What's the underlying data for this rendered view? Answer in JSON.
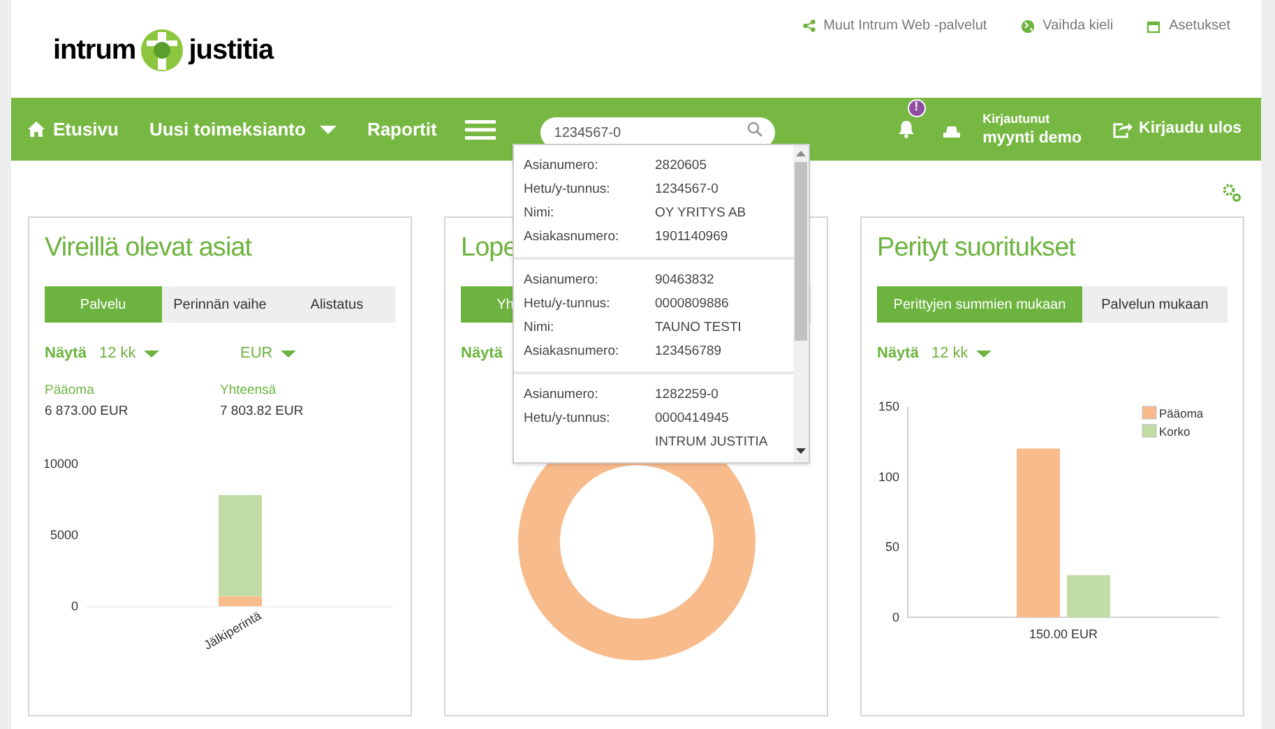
{
  "header": {
    "logo": {
      "left": "intrum",
      "right": "justitia"
    },
    "links": [
      {
        "kind": "share",
        "label": "Muut Intrum Web -palvelut"
      },
      {
        "kind": "globe",
        "label": "Vaihda kieli"
      },
      {
        "kind": "calendar",
        "label": "Asetukset"
      }
    ]
  },
  "nav": {
    "items": [
      {
        "kind": "home",
        "label": "Etusivu"
      },
      {
        "kind": "dropdown",
        "label": "Uusi toimeksianto"
      },
      {
        "kind": "plain",
        "label": "Raportit"
      },
      {
        "kind": "menu"
      }
    ],
    "search": {
      "value": "1234567-0"
    },
    "notifications": {
      "badge": "!"
    },
    "user": {
      "status": "Kirjautunut",
      "name": "myynti demo"
    },
    "logout": "Kirjaudu ulos"
  },
  "search_results": [
    {
      "fields": [
        {
          "label": "Asianumero:",
          "value": "2820605"
        },
        {
          "label": "Hetu/y-tunnus:",
          "value": "1234567-0"
        },
        {
          "label": "Nimi:",
          "value": "OY YRITYS AB"
        },
        {
          "label": "Asiakasnumero:",
          "value": "1901140969"
        }
      ]
    },
    {
      "fields": [
        {
          "label": "Asianumero:",
          "value": "90463832"
        },
        {
          "label": "Hetu/y-tunnus:",
          "value": "0000809886"
        },
        {
          "label": "Nimi:",
          "value": "TAUNO TESTI"
        },
        {
          "label": "Asiakasnumero:",
          "value": "123456789"
        }
      ]
    },
    {
      "fields": [
        {
          "label": "Asianumero:",
          "value": "1282259-0"
        },
        {
          "label": "Hetu/y-tunnus:",
          "value": "0000414945"
        },
        {
          "value": "INTRUM JUSTITIA"
        }
      ]
    }
  ],
  "cards": [
    {
      "kind": "stacked",
      "title": "Vireillä olevat asiat",
      "tabs": [
        {
          "label": "Palvelu",
          "selected": true
        },
        {
          "label": "Perinnän vaihe",
          "selected": false
        },
        {
          "label": "Alistatus",
          "selected": false
        }
      ],
      "filters": [
        {
          "label": "Näytä",
          "value": "12 kk"
        },
        {
          "value": "EUR"
        }
      ],
      "totals": [
        {
          "label": "Pääoma",
          "value": "6 873.00 EUR"
        },
        {
          "label": "Yhteensä",
          "value": "7 803.82 EUR"
        }
      ],
      "chart_data": {
        "type": "bar",
        "stacked": true,
        "categories": [
          "Jälkiperintä"
        ],
        "ylim": [
          0,
          10000
        ],
        "yticks": [
          0,
          5000,
          10000
        ],
        "series": [
          {
            "color": "#f8bb8c",
            "values": [
              700
            ]
          },
          {
            "color": "#c2dca5",
            "values": [
              7100
            ]
          }
        ]
      }
    },
    {
      "kind": "donut",
      "title": "Lope",
      "tabs": [
        {
          "label": "Yh",
          "selected": true
        }
      ],
      "filters": [
        {
          "label": "Näytä"
        }
      ]
    },
    {
      "kind": "grouped",
      "title": "Perityt suoritukset",
      "tabs": [
        {
          "label": "Perittyjen summien mukaan",
          "selected": true
        },
        {
          "label": "Palvelun mukaan",
          "selected": false
        }
      ],
      "filters": [
        {
          "label": "Näytä",
          "value": "12 kk"
        }
      ],
      "chart_data": {
        "type": "bar",
        "categories": [
          "150.00 EUR"
        ],
        "ylim": [
          0,
          150
        ],
        "legend": true,
        "yticks": [
          0,
          50,
          100,
          150
        ],
        "series": [
          {
            "name": "Pääoma",
            "color": "#f8bb8c",
            "values": [
              120
            ]
          },
          {
            "name": "Korko",
            "color": "#c2dca5",
            "values": [
              30
            ]
          }
        ]
      }
    }
  ]
}
